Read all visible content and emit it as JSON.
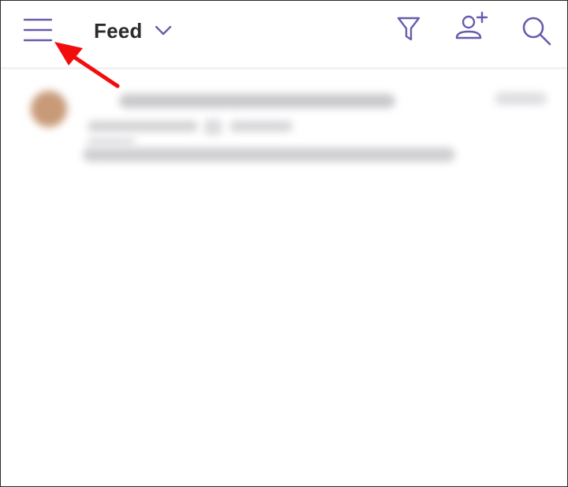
{
  "header": {
    "feed_label": "Feed"
  },
  "icons": {
    "menu": "hamburger-menu-icon",
    "dropdown": "chevron-down-icon",
    "filter": "filter-funnel-icon",
    "add_person": "add-person-icon",
    "search": "search-icon"
  },
  "colors": {
    "accent": "#665CAC",
    "title_text": "#2B2B2B",
    "annotation_arrow": "#F20D0D"
  }
}
